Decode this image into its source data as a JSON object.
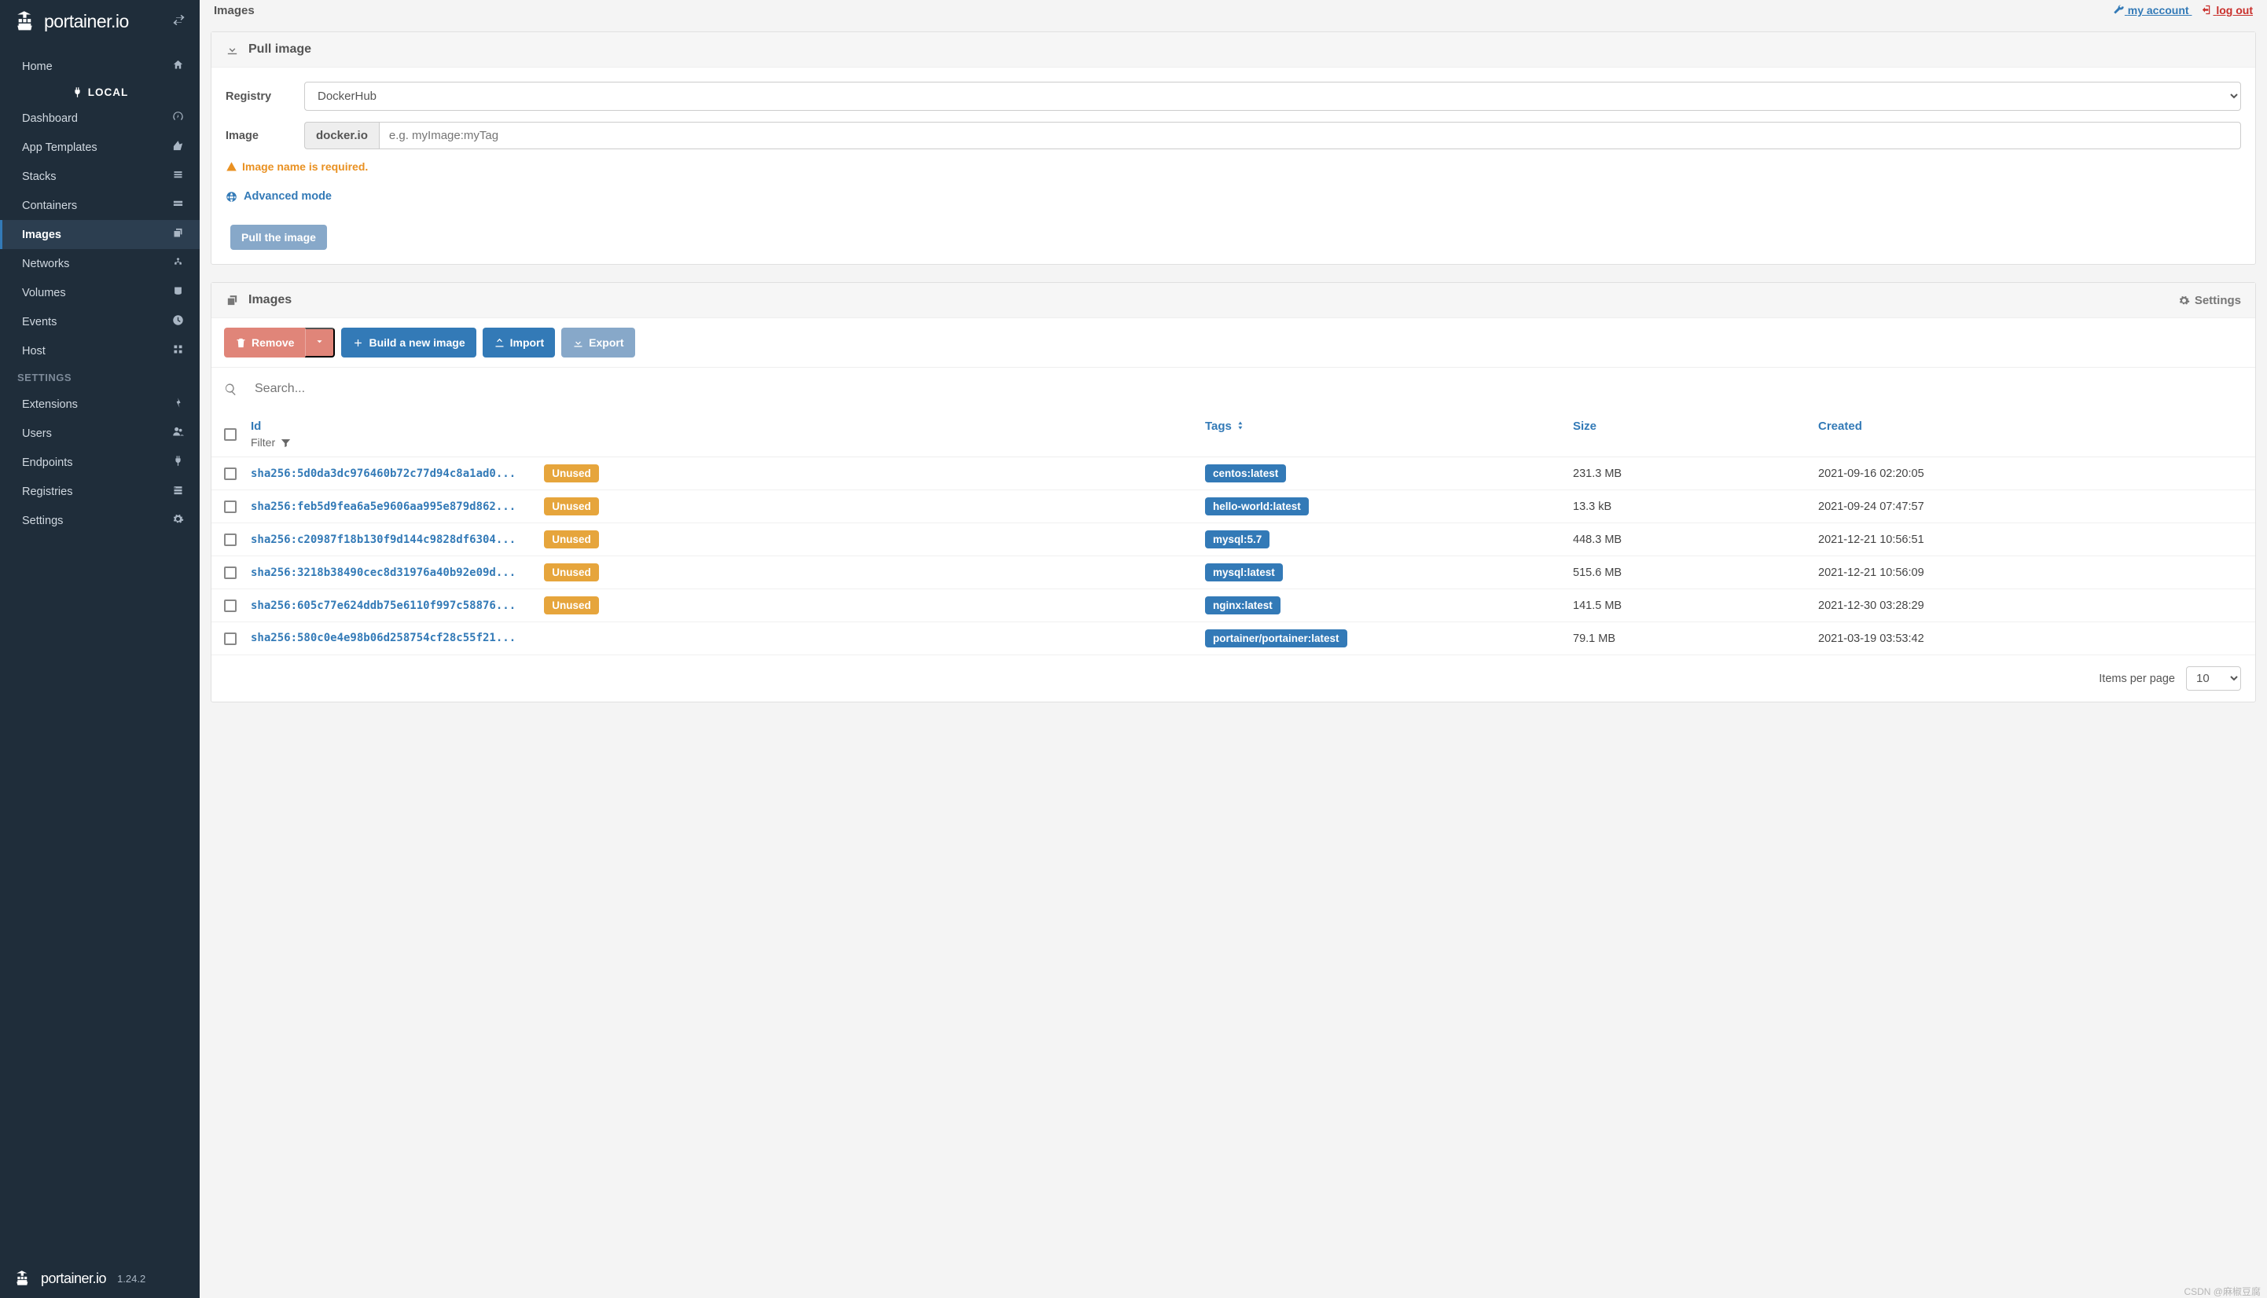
{
  "brand": "portainer.io",
  "version": "1.24.2",
  "top": {
    "title": "Images",
    "my_account": "my account",
    "log_out": "log out"
  },
  "sidebar": {
    "home": "Home",
    "endpoint_label": "LOCAL",
    "items": [
      {
        "label": "Dashboard"
      },
      {
        "label": "App Templates"
      },
      {
        "label": "Stacks"
      },
      {
        "label": "Containers"
      },
      {
        "label": "Images"
      },
      {
        "label": "Networks"
      },
      {
        "label": "Volumes"
      },
      {
        "label": "Events"
      },
      {
        "label": "Host"
      }
    ],
    "settings_header": "SETTINGS",
    "settings": [
      {
        "label": "Extensions"
      },
      {
        "label": "Users"
      },
      {
        "label": "Endpoints"
      },
      {
        "label": "Registries"
      },
      {
        "label": "Settings"
      }
    ]
  },
  "pull": {
    "panel_title": "Pull image",
    "registry_label": "Registry",
    "registry_value": "DockerHub",
    "image_label": "Image",
    "image_prefix": "docker.io",
    "image_placeholder": "e.g. myImage:myTag",
    "warn": "Image name is required.",
    "advanced": "Advanced mode",
    "pull_btn": "Pull the image"
  },
  "list": {
    "panel_title": "Images",
    "settings_btn": "Settings",
    "toolbar": {
      "remove": "Remove",
      "build": "Build a new image",
      "import": "Import",
      "export": "Export"
    },
    "search_placeholder": "Search...",
    "headers": {
      "id": "Id",
      "filter": "Filter",
      "tags": "Tags",
      "size": "Size",
      "created": "Created"
    },
    "rows": [
      {
        "id": "sha256:5d0da3dc976460b72c77d94c8a1ad0...",
        "unused": true,
        "tags": [
          "centos:latest"
        ],
        "size": "231.3 MB",
        "created": "2021-09-16 02:20:05"
      },
      {
        "id": "sha256:feb5d9fea6a5e9606aa995e879d862...",
        "unused": true,
        "tags": [
          "hello-world:latest"
        ],
        "size": "13.3 kB",
        "created": "2021-09-24 07:47:57"
      },
      {
        "id": "sha256:c20987f18b130f9d144c9828df6304...",
        "unused": true,
        "tags": [
          "mysql:5.7"
        ],
        "size": "448.3 MB",
        "created": "2021-12-21 10:56:51"
      },
      {
        "id": "sha256:3218b38490cec8d31976a40b92e09d...",
        "unused": true,
        "tags": [
          "mysql:latest"
        ],
        "size": "515.6 MB",
        "created": "2021-12-21 10:56:09"
      },
      {
        "id": "sha256:605c77e624ddb75e6110f997c58876...",
        "unused": true,
        "tags": [
          "nginx:latest"
        ],
        "size": "141.5 MB",
        "created": "2021-12-30 03:28:29"
      },
      {
        "id": "sha256:580c0e4e98b06d258754cf28c55f21...",
        "unused": false,
        "tags": [
          "portainer/portainer:latest"
        ],
        "size": "79.1 MB",
        "created": "2021-03-19 03:53:42"
      }
    ],
    "items_per_page_label": "Items per page",
    "items_per_page": "10",
    "unused_label": "Unused"
  },
  "watermark": "CSDN @麻椒豆腐"
}
